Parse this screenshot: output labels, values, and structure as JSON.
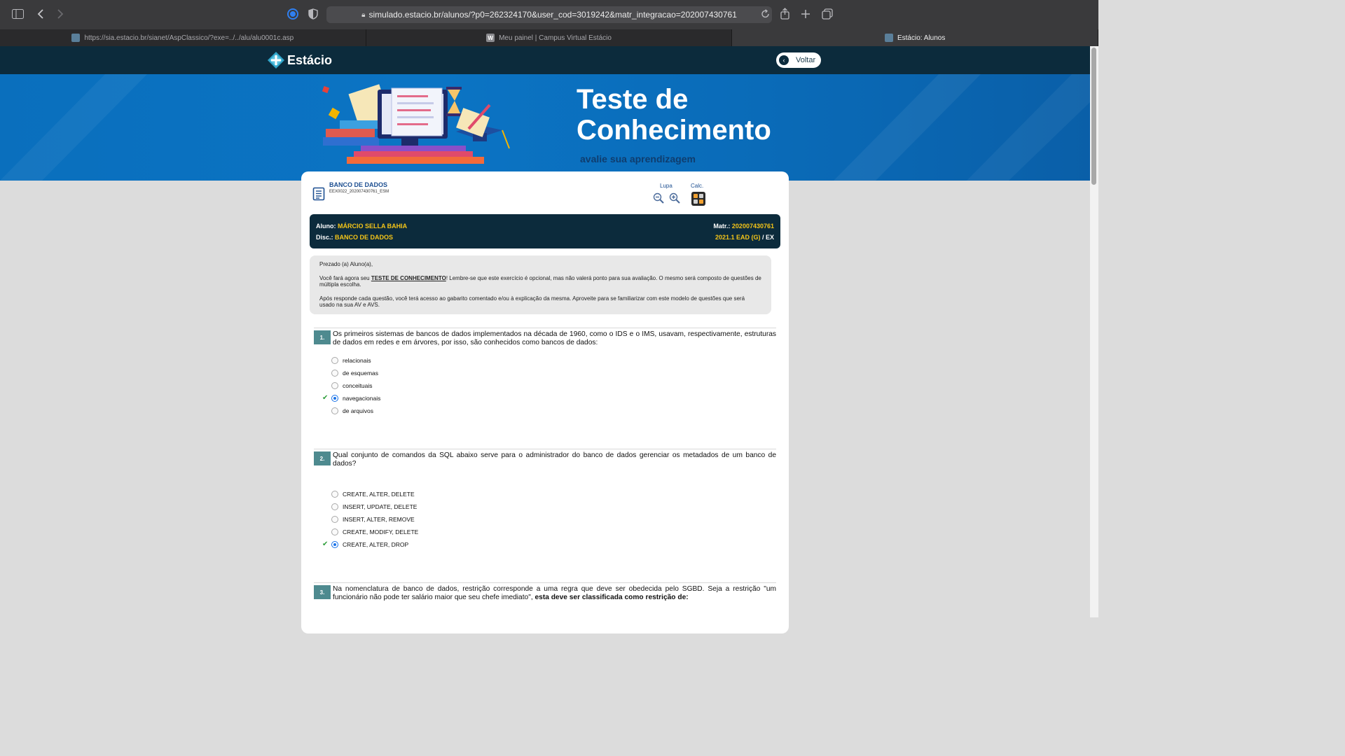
{
  "browser": {
    "url": "simulado.estacio.br/alunos/?p0=262324170&user_cod=3019242&matr_integracao=202007430761",
    "tabs": [
      {
        "label": "https://sia.estacio.br/sianet/AspClassico/?exe=../../alu/alu0001c.asp",
        "active": false
      },
      {
        "label": "Meu painel | Campus Virtual Estácio",
        "active": false,
        "favicon_letter": "W"
      },
      {
        "label": "Estácio: Alunos",
        "active": true
      }
    ]
  },
  "header": {
    "logo_text": "Estácio",
    "back_label": "Voltar"
  },
  "banner": {
    "title_line1": "Teste de",
    "title_line2": "Conhecimento",
    "subtitle": "avalie sua aprendizagem"
  },
  "course": {
    "title": "BANCO DE DADOS",
    "code": "EEX0022_202007430761_ESM"
  },
  "tools": {
    "zoom_label": "Lupa",
    "calc_label": "Calc."
  },
  "student": {
    "aluno_key": "Aluno:",
    "aluno_value": "MÁRCIO SELLA BAHIA",
    "disc_key": "Disc.:",
    "disc_value": "BANCO DE DADOS",
    "matr_key": "Matr.:",
    "matr_value": "202007430761",
    "period_value": "2021.1 EAD (G)",
    "period_sep": " / ",
    "period_suffix": "EX"
  },
  "intro": {
    "greeting": "Prezado (a) Aluno(a),",
    "p1_before": "Você fará agora seu ",
    "p1_emph": "TESTE DE CONHECIMENTO",
    "p1_after": "! Lembre-se que este exercício é opcional, mas não valerá ponto para sua avaliação. O mesmo será composto de questões de múltipla escolha.",
    "p2": "Após responde cada questão, você terá acesso ao gabarito comentado e/ou à explicação da mesma. Aproveite para se familiarizar com este modelo de questões que será usado na sua AV e AVS."
  },
  "questions": [
    {
      "number": "1.",
      "text": "Os primeiros sistemas de bancos de dados implementados na década de 1960, como o IDS e o IMS, usavam, respectivamente, estruturas de dados em redes e em árvores, por isso, são conhecidos como bancos de dados:",
      "options": [
        "relacionais",
        "de esquemas",
        "conceituais",
        "navegacionais",
        "de arquivos"
      ],
      "selected": 3
    },
    {
      "number": "2.",
      "text": "Qual conjunto de comandos da SQL abaixo serve para o administrador do banco de dados gerenciar os metadados de um banco de dados?",
      "options": [
        "CREATE, ALTER, DELETE",
        "INSERT, UPDATE, DELETE",
        "INSERT, ALTER, REMOVE",
        "CREATE, MODIFY, DELETE",
        "CREATE, ALTER, DROP"
      ],
      "selected": 4
    },
    {
      "number": "3.",
      "text_before": "Na nomenclatura de banco de dados, restrição corresponde a uma regra que deve ser obedecida pelo SGBD. Seja a restrição \"um funcionário não pode ter salário maior que seu chefe imediato\", ",
      "text_emph": "esta deve ser classificada como restrição de:"
    }
  ]
}
